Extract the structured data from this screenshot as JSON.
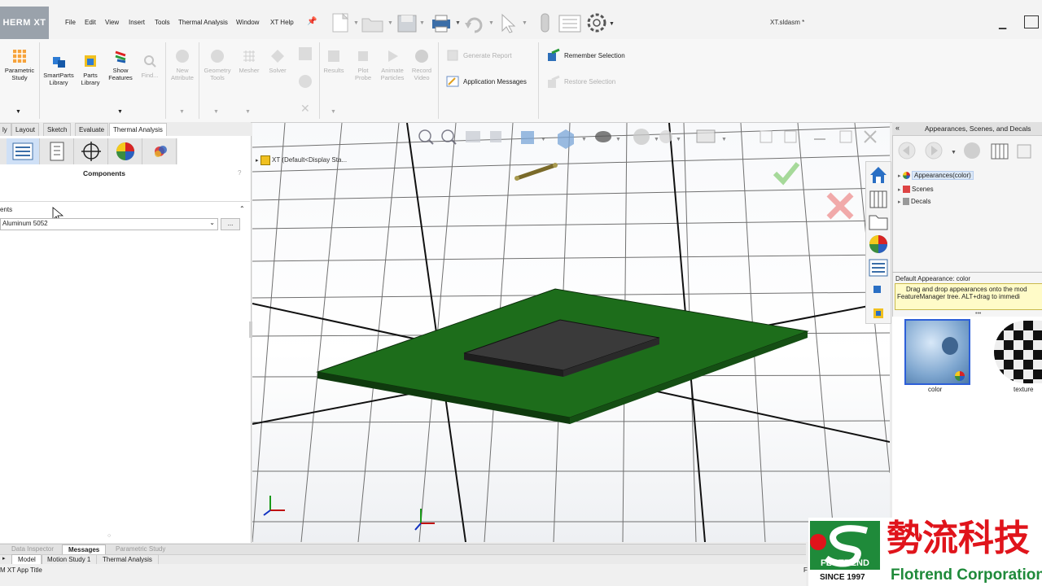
{
  "app": {
    "logo": "HERM XT",
    "doc_title": "XT.sldasm *"
  },
  "menu": [
    "File",
    "Edit",
    "View",
    "Insert",
    "Tools",
    "Thermal Analysis",
    "Window",
    "XT Help"
  ],
  "ribbon": {
    "parametric_study": [
      "Parametric",
      "Study"
    ],
    "smartparts": [
      "SmartParts",
      "Library"
    ],
    "parts": [
      "Parts",
      "Library"
    ],
    "show": [
      "Show",
      "Features"
    ],
    "find": "Find...",
    "new_attr": [
      "New",
      "Attribute"
    ],
    "geometry": [
      "Geometry",
      "Tools"
    ],
    "mesher": "Mesher",
    "solver": "Solver",
    "results": "Results",
    "plot_probe": [
      "Plot",
      "Probe"
    ],
    "animate": [
      "Animate",
      "Particles"
    ],
    "record": [
      "Record",
      "Video"
    ],
    "generate_report": "Generate Report",
    "app_messages": "Application Messages",
    "remember": "Remember Selection",
    "restore": "Restore Selection"
  },
  "tabs": [
    "ly",
    "Layout",
    "Sketch",
    "Evaluate",
    "Thermal Analysis"
  ],
  "left": {
    "title": "Components",
    "help": "?",
    "section": "ents",
    "material_value": "Aluminum 5052",
    "more_btn": "..."
  },
  "viewport": {
    "tree_label": "XT  (Default<Display Sta..."
  },
  "right": {
    "title": "Appearances, Scenes, and Decals",
    "tree": [
      "Appearances(color)",
      "Scenes",
      "Decals"
    ],
    "default_label": "Default Appearance: color",
    "tip_line1": "Drag and drop appearances onto the mod",
    "tip_line2": "FeatureManager tree.  ALT+drag to immedi",
    "swatches": [
      "color",
      "texture"
    ]
  },
  "bottom": {
    "tabs1": [
      "Data Inspector",
      "Messages",
      "Parametric Study"
    ],
    "tabs2": [
      "Model",
      "Motion Study 1",
      "Thermal Analysis"
    ],
    "status": "M XT App Title",
    "status_right": "F"
  },
  "brand": {
    "cn": "勢流科技",
    "name": "FLOTREND",
    "since": "SINCE 1997",
    "en": "Flotrend Corporation",
    "red": "#e0141b",
    "green": "#1f8a3a"
  }
}
